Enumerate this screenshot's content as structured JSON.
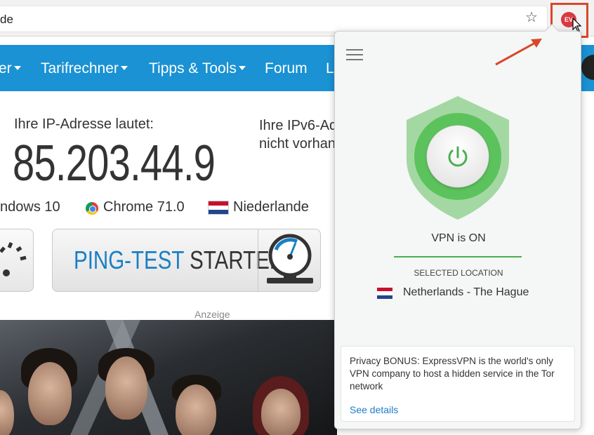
{
  "browser": {
    "url_fragment": "de",
    "bookmark_icon": "star-icon",
    "extension_icon": "expressvpn-icon",
    "extension_icon_text": "EV"
  },
  "nav": {
    "items": [
      {
        "label": "er",
        "dropdown": true
      },
      {
        "label": "Tarifrechner",
        "dropdown": true
      },
      {
        "label": "Tipps & Tools",
        "dropdown": true
      },
      {
        "label": "Forum",
        "dropdown": false
      },
      {
        "label": "L",
        "dropdown": false
      }
    ],
    "color": "#1a92d4"
  },
  "ip": {
    "label": "Ihre IP-Adresse lautet:",
    "value": "85.203.44.9",
    "ipv6_line1": "Ihre IPv6-Ad",
    "ipv6_line2": "nicht vorhan"
  },
  "info": {
    "os": "ndows 10",
    "browser": "Chrome 71.0",
    "country": "Niederlande"
  },
  "buttons": {
    "ping_part1": "PING-TEST",
    "ping_part2": "STARTEN"
  },
  "ad_label": "Anzeige",
  "vpn": {
    "menu_icon": "hamburger-icon",
    "status": "VPN is ON",
    "selected_location_label": "SELECTED LOCATION",
    "location": "Netherlands - The Hague",
    "bonus_text": "Privacy BONUS: ExpressVPN is the world's only VPN company to host a hidden service in the Tor network",
    "bonus_link": "See details",
    "accent": "#4caf50"
  },
  "annotation_color": "#d9472b"
}
